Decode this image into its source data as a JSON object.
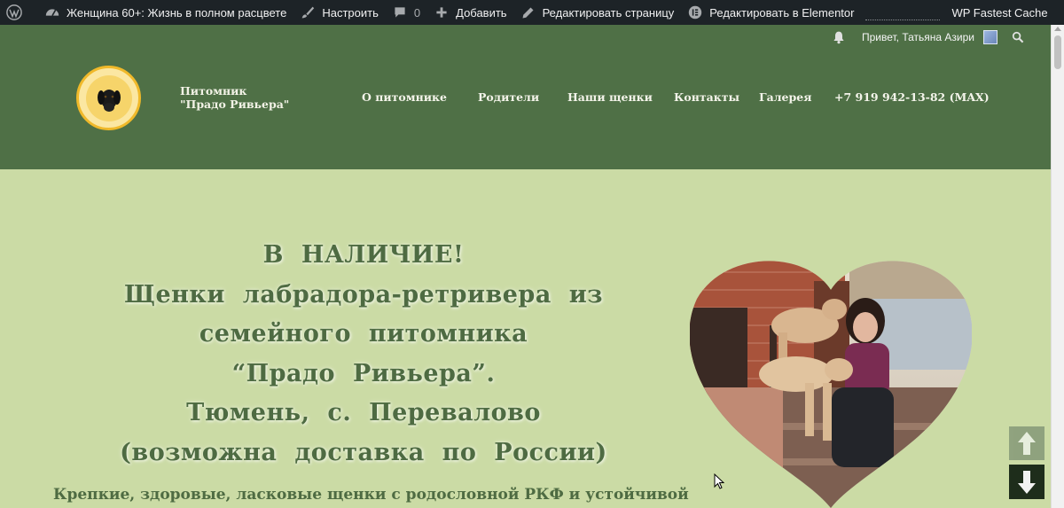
{
  "adminbar": {
    "site_name": "Женщина 60+: Жизнь в полном расцвете",
    "customize": "Настроить",
    "comments_count": "0",
    "add_new": "Добавить",
    "edit_page": "Редактировать страницу",
    "edit_elementor": "Редактировать в Elementor",
    "cache": "WP Fastest Cache"
  },
  "header": {
    "greeting": "Привет, Татьяна Азири",
    "title_line1": "Питомник",
    "title_line2": "\"Прадо Ривьера\"",
    "nav": [
      "О питомнике",
      "Родители",
      "Наши щенки",
      "Контакты",
      "Галерея",
      "+7 919 942-13-82 (MAX)"
    ]
  },
  "hero": {
    "lines": [
      "В НАЛИЧИЕ!",
      "Щенки лабрадора-ретривера из",
      "семейного питомника",
      "“Прадо Ривьера”.",
      "Тюмень, с. Перевалово",
      "(возможна доставка по России)"
    ],
    "subtext": "Крепкие, здоровые, ласковые щенки с родословной РКФ и устойчивой"
  },
  "colors": {
    "header_bg": "#4f7046",
    "page_bg": "#cbdba5",
    "heading": "#4e6b42",
    "adminbar": "#1d2327"
  },
  "icons": [
    "wordpress-icon",
    "dashboard-icon",
    "brush-icon",
    "comment-icon",
    "plus-icon",
    "pencil-icon",
    "elementor-icon",
    "bell-icon",
    "search-icon",
    "arrow-up-icon",
    "arrow-down-icon"
  ]
}
